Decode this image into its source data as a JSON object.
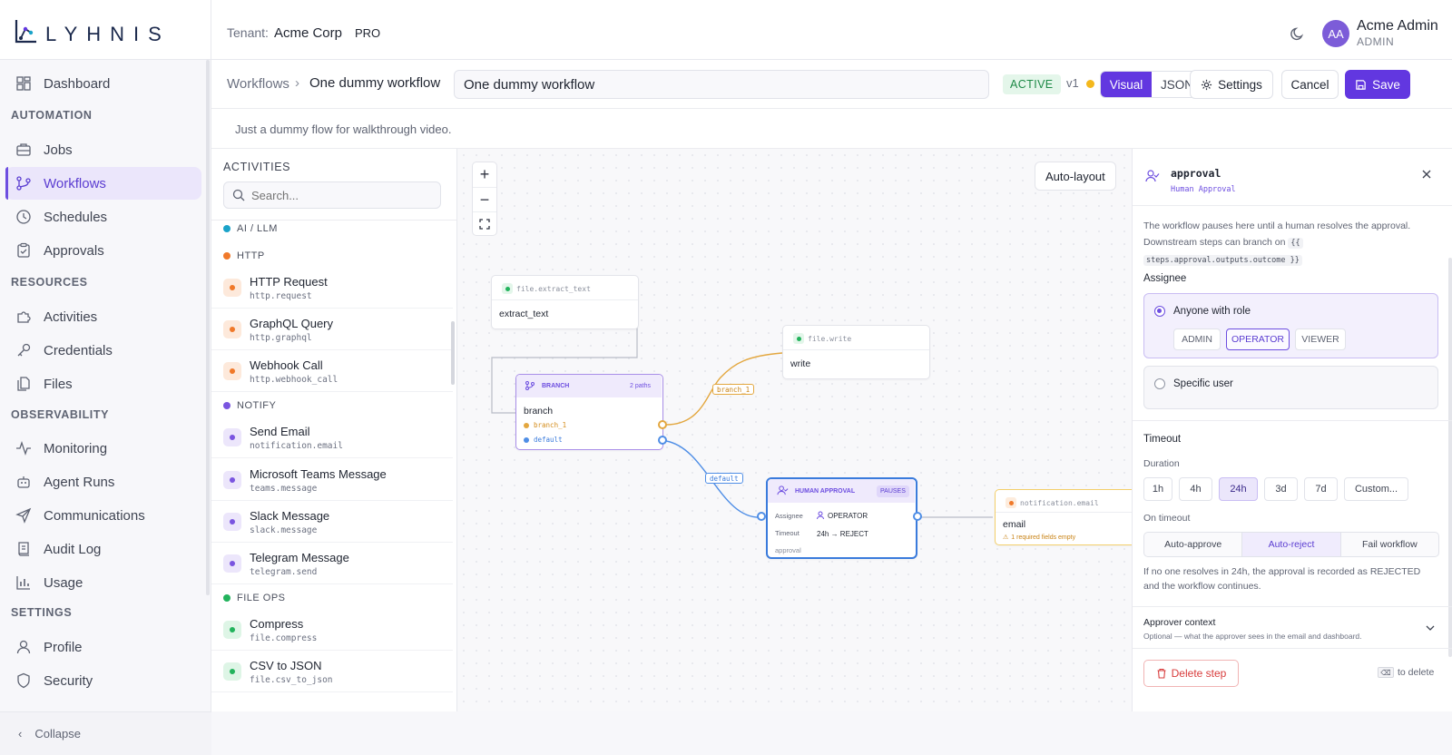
{
  "brand": {
    "name": "LYHNIS",
    "accent": "#6237e0"
  },
  "tenant": {
    "label": "Tenant:",
    "name": "Acme Corp",
    "plan": "PRO"
  },
  "user": {
    "initials": "AA",
    "name": "Acme Admin",
    "role": "ADMIN"
  },
  "sidebar": {
    "sections": {
      "automation": "AUTOMATION",
      "resources": "RESOURCES",
      "observability": "OBSERVABILITY",
      "settings": "SETTINGS"
    },
    "items": {
      "dashboard": "Dashboard",
      "jobs": "Jobs",
      "workflows": "Workflows",
      "schedules": "Schedules",
      "approvals": "Approvals",
      "activities": "Activities",
      "credentials": "Credentials",
      "files": "Files",
      "monitoring": "Monitoring",
      "agent_runs": "Agent Runs",
      "communications": "Communications",
      "audit_log": "Audit Log",
      "usage": "Usage",
      "profile": "Profile",
      "security": "Security"
    },
    "active": "Workflows",
    "collapse": "Collapse"
  },
  "header": {
    "breadcrumb_root": "Workflows",
    "breadcrumb_sep": "›",
    "breadcrumb_current": "One dummy workflow",
    "name_value": "One dummy workflow",
    "status": "ACTIVE",
    "version": "v1",
    "view_modes": [
      "Visual",
      "JSON"
    ],
    "view_selected": "Visual",
    "settings": "Settings",
    "cancel": "Cancel",
    "save": "Save"
  },
  "description": "Just a dummy flow for walkthrough video.",
  "activities": {
    "title": "ACTIVITIES",
    "search_placeholder": "Search...",
    "categories": {
      "ai": {
        "label": "AI / LLM",
        "color": "#1aa3c9"
      },
      "http": {
        "label": "HTTP",
        "color": "#f0792a"
      },
      "notify": {
        "label": "NOTIFY",
        "color": "#7a55e0"
      },
      "fileops": {
        "label": "FILE OPS",
        "color": "#22b35c"
      }
    },
    "items": [
      {
        "name": "HTTP Request",
        "id": "http.request"
      },
      {
        "name": "GraphQL Query",
        "id": "http.graphql"
      },
      {
        "name": "Webhook Call",
        "id": "http.webhook_call"
      },
      {
        "name": "Send Email",
        "id": "notification.email"
      },
      {
        "name": "Microsoft Teams Message",
        "id": "teams.message"
      },
      {
        "name": "Slack Message",
        "id": "slack.message"
      },
      {
        "name": "Telegram Message",
        "id": "telegram.send"
      },
      {
        "name": "Compress",
        "id": "file.compress"
      },
      {
        "name": "CSV to JSON",
        "id": "file.csv_to_json"
      }
    ]
  },
  "canvas": {
    "zoom_in": "+",
    "zoom_out": "−",
    "auto_layout": "Auto-layout",
    "nodes": {
      "extract": {
        "type": "file.extract_text",
        "title": "extract_text"
      },
      "write": {
        "type": "file.write",
        "title": "write"
      },
      "branch": {
        "kind": "BRANCH",
        "paths": "2 paths",
        "title": "branch",
        "path1": "branch_1",
        "path2": "default"
      },
      "approval": {
        "kind": "HUMAN APPROVAL",
        "badge": "PAUSES",
        "assignee_label": "Assignee",
        "assignee_value": "OPERATOR",
        "timeout_label": "Timeout",
        "timeout_value": "24h → REJECT",
        "id": "approval"
      },
      "email": {
        "type": "notification.email",
        "title": "email",
        "warning": "1 required fields empty"
      }
    },
    "edge_labels": {
      "branch": "branch_1",
      "default": "default"
    }
  },
  "panel": {
    "title": "approval",
    "subtitle": "Human Approval",
    "help_text": "The workflow pauses here until a human resolves the approval. Downstream steps can branch on",
    "help_code_1": "{{",
    "help_code_2": "steps.approval.outputs.outcome }}",
    "assignee_label": "Assignee",
    "assignee_options": [
      "Anyone with role",
      "Specific user"
    ],
    "roles": [
      "ADMIN",
      "OPERATOR",
      "VIEWER"
    ],
    "role_selected": "OPERATOR",
    "timeout_label": "Timeout",
    "duration_label": "Duration",
    "durations": [
      "1h",
      "4h",
      "24h",
      "3d",
      "7d",
      "Custom..."
    ],
    "duration_selected": "24h",
    "on_timeout_label": "On timeout",
    "on_timeout_options": [
      "Auto-approve",
      "Auto-reject",
      "Fail workflow"
    ],
    "on_timeout_selected": "Auto-reject",
    "timeout_note": "If no one resolves in 24h, the approval is recorded as REJECTED and the workflow continues.",
    "approver_context_title": "Approver context",
    "approver_context_sub": "Optional — what the approver sees in the email and dashboard.",
    "delete": "Delete step",
    "delete_hint": "to delete"
  }
}
